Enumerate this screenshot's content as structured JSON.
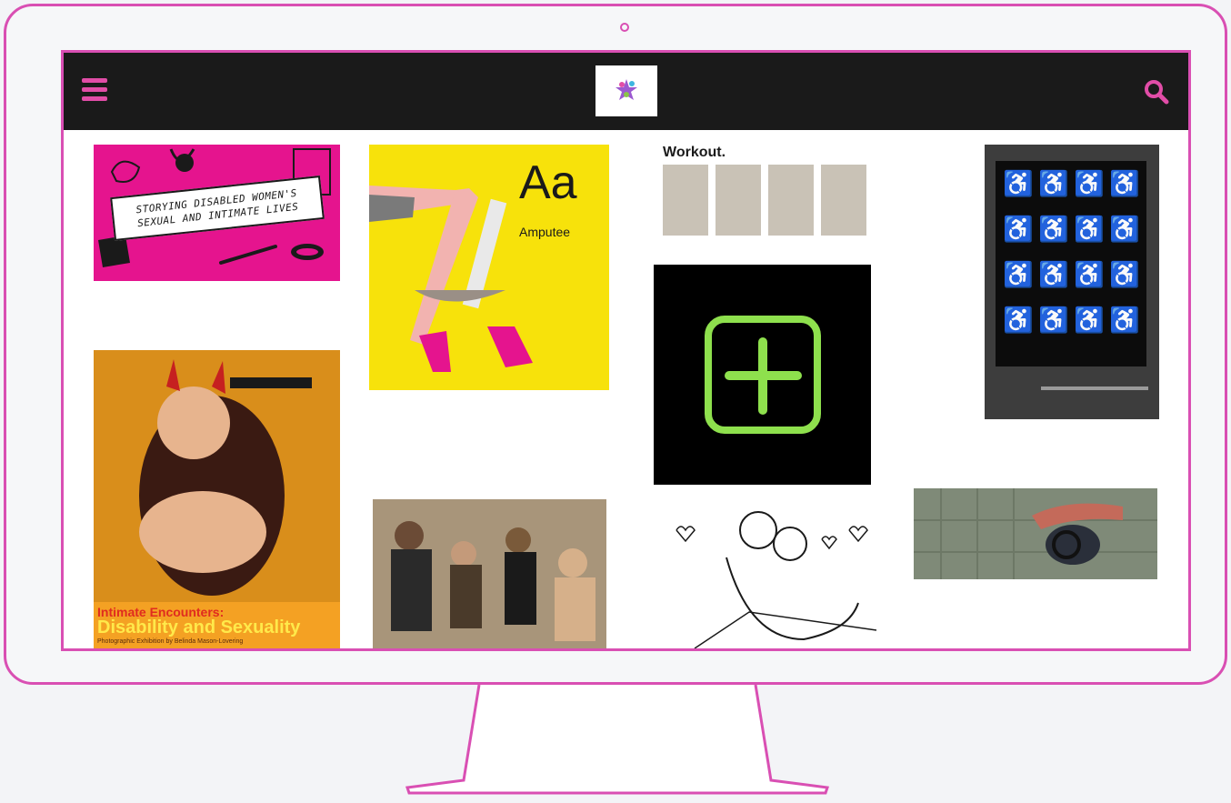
{
  "colors": {
    "accent": "#d94fb3",
    "topbar": "#1a1a1a",
    "icon_pink": "#e14da7"
  },
  "header": {
    "menu_icon": "hamburger-icon",
    "search_icon": "search-icon"
  },
  "tiles": {
    "storying": {
      "line1": "STORYING DISABLED WOMEN'S",
      "line2": "SEXUAL AND INTIMATE LIVES"
    },
    "amputee": {
      "letter": "Aa",
      "word": "Amputee"
    },
    "workout": {
      "title": "Workout."
    },
    "encounters": {
      "line1": "Intimate Encounters:",
      "line2": "Disability and Sexuality",
      "line3": "Photographic Exhibition by Belinda Mason-Lovering"
    }
  }
}
